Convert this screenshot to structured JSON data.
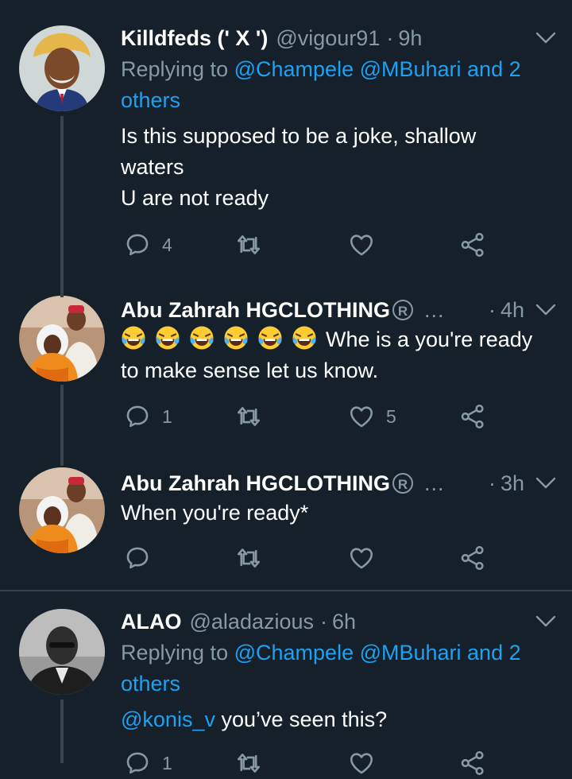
{
  "tweets": [
    {
      "name": "Killdfeds (' X ')",
      "handle": "@vigour91",
      "time": "9h",
      "replying_prefix": "Replying to",
      "replying_to": "@Champele @MBuhari and 2",
      "replying_to_cont": "others",
      "text_line1": "Is this supposed to be a joke, shallow",
      "text_line2": "waters",
      "text_line3": "U are not ready",
      "replies": "4",
      "retweets": "",
      "likes": ""
    },
    {
      "name": "Abu Zahrah HGCLOTHING",
      "reg_mark": "R",
      "ellipsis": "...",
      "time": "4h",
      "emoji_count": 6,
      "text_line1": "Whe is a you're ready",
      "text_line2": "to make sense let us know.",
      "replies": "1",
      "retweets": "",
      "likes": "5"
    },
    {
      "name": "Abu Zahrah HGCLOTHING",
      "reg_mark": "R",
      "ellipsis": "...",
      "time": "3h",
      "text_line1": "When you're ready*",
      "replies": "",
      "retweets": "",
      "likes": ""
    },
    {
      "name": "ALAO",
      "handle": "@aladazious",
      "time": "6h",
      "replying_prefix": "Replying to",
      "replying_to": "@Champele @MBuhari and 2",
      "replying_to_cont": "others",
      "mention": "@konis_v",
      "text_line1": "you’ve seen this?",
      "replies": "1",
      "retweets": "",
      "likes": ""
    }
  ],
  "colors": {
    "background": "#15202b",
    "secondary_text": "#8899a6",
    "link": "#1da1f2",
    "divider": "#38444d"
  },
  "icons": [
    "reply-icon",
    "retweet-icon",
    "like-icon",
    "share-icon",
    "chevron-down-icon",
    "laughing-tears-emoji"
  ]
}
